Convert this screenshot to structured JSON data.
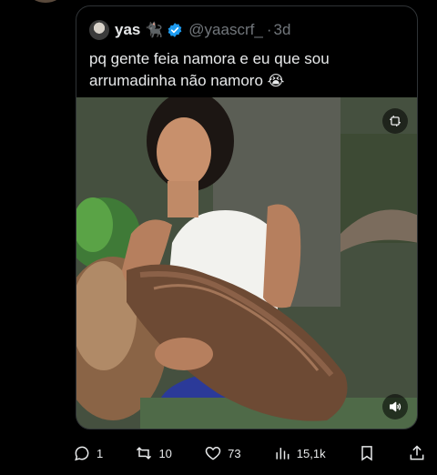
{
  "quoted_tweet": {
    "author_name": "yas",
    "author_emoji": "🐈‍⬛",
    "handle": "@yaascrf_",
    "separator": "·",
    "time": "3d",
    "text": "pq gente feia namora e eu que sou arrumadinha não namoro",
    "text_emoji": "😭",
    "media_icons": [
      "gif-toggle-icon",
      "volume-icon"
    ]
  },
  "actions": {
    "replies": "1",
    "retweets": "10",
    "likes": "73",
    "views": "15,1k"
  },
  "colors": {
    "background": "#000000",
    "text": "#e7e9ea",
    "muted": "#71767b",
    "border": "#2f3336",
    "verified": "#1d9bf0"
  }
}
